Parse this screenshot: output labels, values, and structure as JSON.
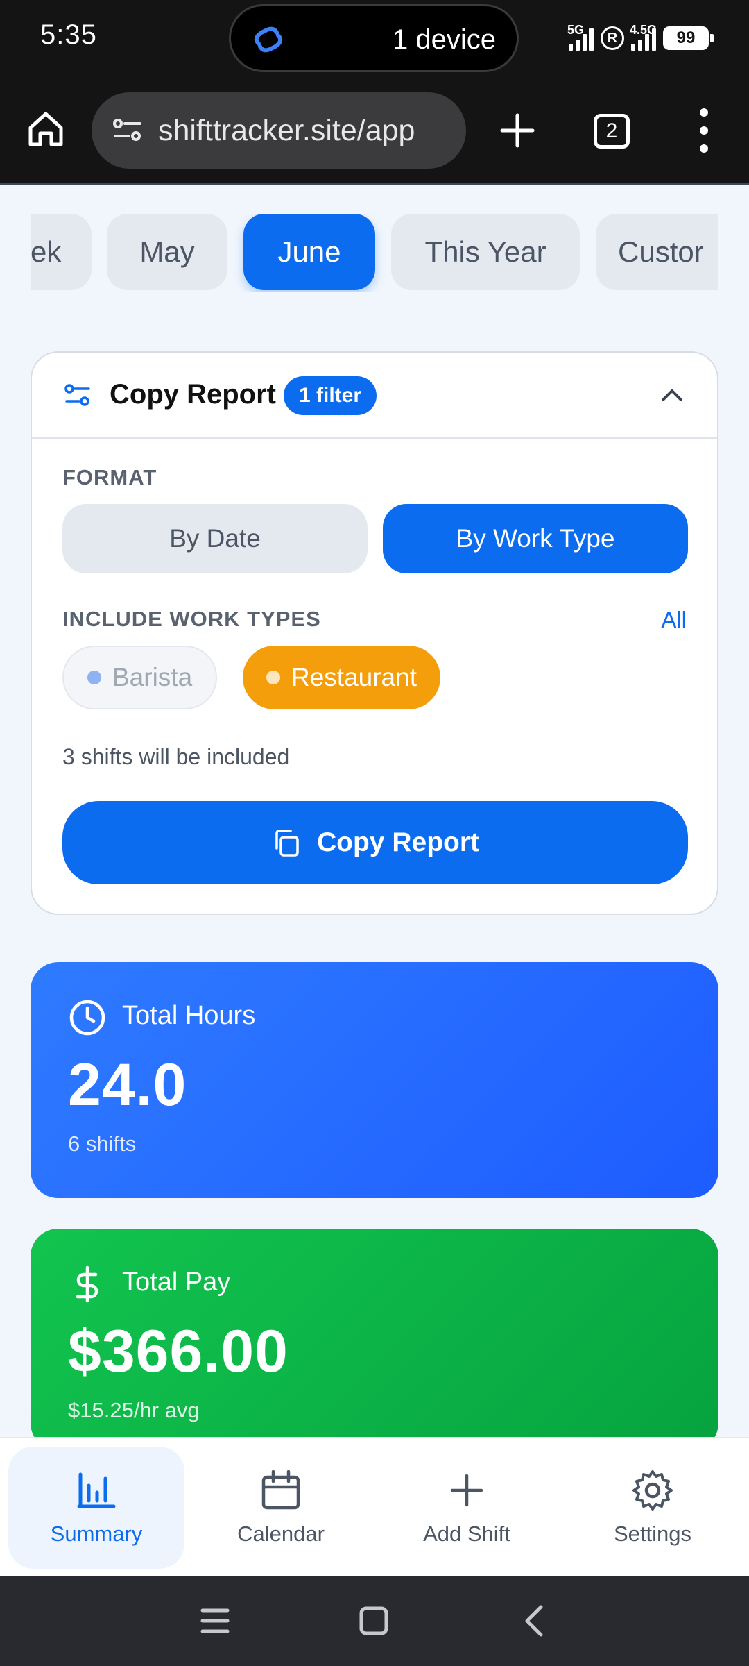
{
  "status_bar": {
    "time": "5:35",
    "pill_text": "1 device",
    "network_1": "5G",
    "network_2": "4.5G",
    "roaming": "R",
    "battery": "99"
  },
  "browser": {
    "url": "shifttracker.site/app",
    "tab_count": "2"
  },
  "periods": [
    {
      "label": "ek",
      "active": false
    },
    {
      "label": "May",
      "active": false
    },
    {
      "label": "June",
      "active": true
    },
    {
      "label": "This Year",
      "active": false
    },
    {
      "label": "Custor",
      "active": false
    }
  ],
  "report": {
    "title": "Copy Report",
    "filter_badge": "1 filter",
    "format_label": "FORMAT",
    "format_options": [
      "By Date",
      "By Work Type"
    ],
    "format_selected": "By Work Type",
    "include_label": "INCLUDE WORK TYPES",
    "all_link": "All",
    "work_types": [
      {
        "label": "Barista",
        "selected": false,
        "color": "#8fb3f0"
      },
      {
        "label": "Restaurant",
        "selected": true,
        "color": "#f59e0b"
      }
    ],
    "shifts_note": "3 shifts will be included",
    "copy_button": "Copy Report"
  },
  "stats": {
    "hours": {
      "label": "Total Hours",
      "value": "24.0",
      "sub": "6 shifts",
      "icon": "clock-icon"
    },
    "pay": {
      "label": "Total Pay",
      "value": "$366.00",
      "sub": "$15.25/hr avg",
      "icon": "dollar-icon"
    }
  },
  "nav": {
    "items": [
      {
        "label": "Summary",
        "icon": "bar-chart-icon",
        "active": true
      },
      {
        "label": "Calendar",
        "icon": "calendar-icon",
        "active": false
      },
      {
        "label": "Add Shift",
        "icon": "plus-icon",
        "active": false
      },
      {
        "label": "Settings",
        "icon": "gear-icon",
        "active": false
      }
    ]
  },
  "colors": {
    "accent": "#0b6cf0",
    "hours_card": "#2f7bff",
    "pay_card": "#12c44f",
    "restaurant": "#f59e0b"
  }
}
